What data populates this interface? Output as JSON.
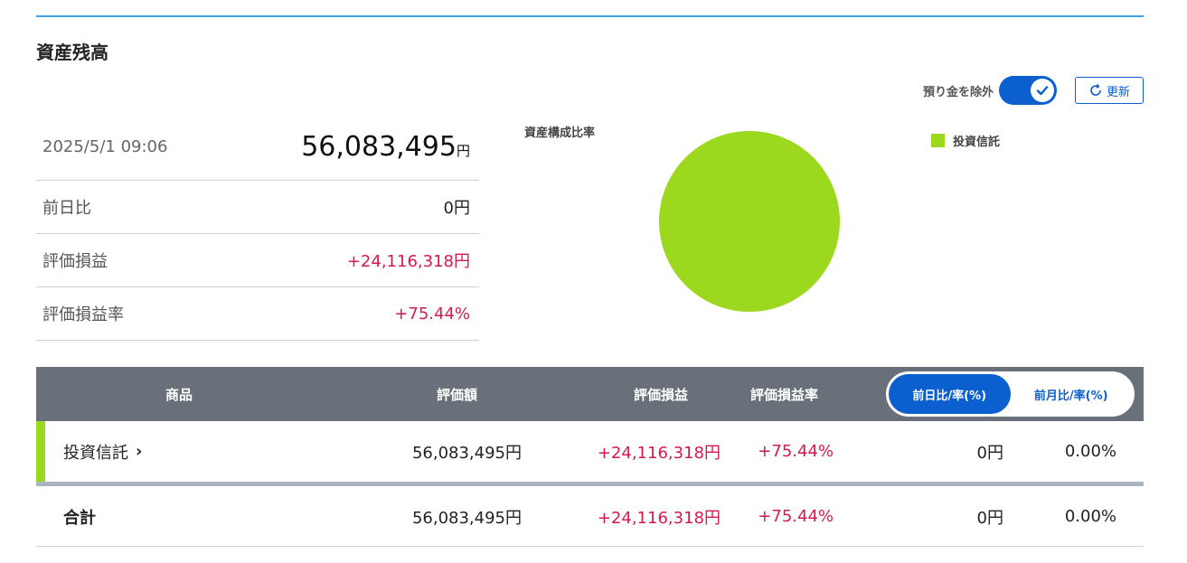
{
  "section": {
    "title": "資産残高"
  },
  "controls": {
    "toggle_label": "預り金を除外",
    "toggle_on": true,
    "refresh_label": "更新"
  },
  "summary": {
    "datetime": "2025/5/1 09:06",
    "total_value": "56,083,495",
    "total_unit": "円",
    "rows": [
      {
        "label": "前日比",
        "value": "0円"
      },
      {
        "label": "評価損益",
        "value": "+24,116,318円"
      },
      {
        "label": "評価損益率",
        "value": "+75.44%"
      }
    ]
  },
  "chart_data": {
    "type": "pie",
    "title": "資産構成比率",
    "categories": [
      "投資信託"
    ],
    "values": [
      100
    ],
    "colors": [
      "#9bd81e"
    ],
    "legend_position": "top-right"
  },
  "table": {
    "headers": {
      "product": "商品",
      "value": "評価額",
      "gain": "評価損益",
      "gain_rate": "評価損益率"
    },
    "segment": {
      "options": [
        "前日比/率(%)",
        "前月比/率(%)"
      ],
      "selected": "前日比/率(%)"
    },
    "rows": [
      {
        "name": "投資信託",
        "value": "56,083,495円",
        "gain": "+24,116,318円",
        "gain_rate": "+75.44%",
        "change": "0円",
        "change_rate": "0.00%"
      }
    ],
    "total": {
      "label": "合計",
      "value": "56,083,495円",
      "gain": "+24,116,318円",
      "gain_rate": "+75.44%",
      "change": "0円",
      "change_rate": "0.00%"
    }
  },
  "colors": {
    "accent": "#0b5fcf",
    "positive": "#d6194d",
    "fund": "#9bd81e",
    "header_bg": "#697079",
    "top_rule": "#3ea3e8"
  }
}
